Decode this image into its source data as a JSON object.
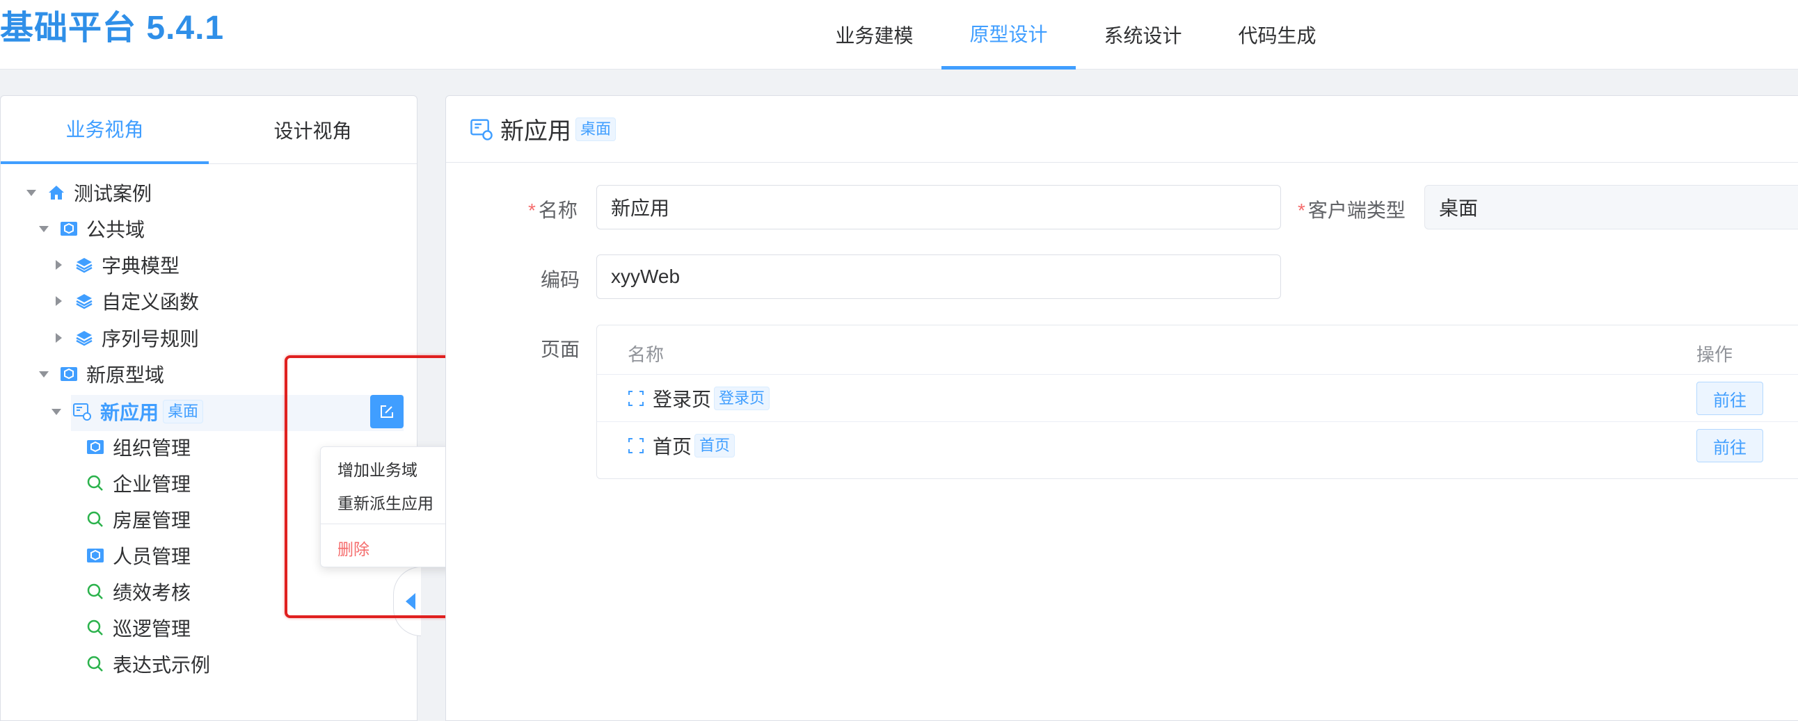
{
  "app": {
    "title": "基础平台 5.4.1"
  },
  "nav": {
    "items": [
      {
        "label": "业务建模"
      },
      {
        "label": "原型设计"
      },
      {
        "label": "系统设计"
      },
      {
        "label": "代码生成"
      }
    ],
    "active": "原型设计"
  },
  "sidebar": {
    "tabs": [
      {
        "label": "业务视角"
      },
      {
        "label": "设计视角"
      }
    ],
    "active_tab": "业务视角",
    "tree": {
      "root": {
        "label": "测试案例"
      },
      "public_domain": {
        "label": "公共域"
      },
      "dict_model": {
        "label": "字典模型"
      },
      "custom_func": {
        "label": "自定义函数"
      },
      "serial_rule": {
        "label": "序列号规则"
      },
      "new_proto_domain": {
        "label": "新原型域"
      },
      "new_app": {
        "label": "新应用",
        "tag": "桌面"
      },
      "children": [
        {
          "label": "组织管理",
          "icon": "domain-icon"
        },
        {
          "label": "企业管理",
          "icon": "search-icon"
        },
        {
          "label": "房屋管理",
          "icon": "search-icon"
        },
        {
          "label": "人员管理",
          "icon": "domain-icon"
        },
        {
          "label": "绩效考核",
          "icon": "search-icon"
        },
        {
          "label": "巡逻管理",
          "icon": "search-icon"
        },
        {
          "label": "表达式示例",
          "icon": "search-icon"
        }
      ]
    }
  },
  "context_menu": {
    "items": [
      {
        "label": "增加业务域"
      },
      {
        "label": "重新派生应用"
      },
      {
        "label": "删除"
      }
    ]
  },
  "detail": {
    "title": "新应用",
    "title_tag": "桌面",
    "name_label": "名称",
    "name_value": "新应用",
    "client_type_label": "客户端类型",
    "client_type_value": "桌面",
    "code_label": "编码",
    "code_value": "xyyWeb",
    "pages_label": "页面",
    "table": {
      "columns": [
        "名称",
        "操作"
      ],
      "rows": [
        {
          "name": "登录页",
          "tag": "登录页",
          "action": "前往"
        },
        {
          "name": "首页",
          "tag": "首页",
          "action": "前往"
        }
      ]
    }
  },
  "colors": {
    "accent": "#409eff",
    "brand": "#2f8fe8",
    "danger": "#f56c6c",
    "highlight_box": "#e0201f"
  }
}
